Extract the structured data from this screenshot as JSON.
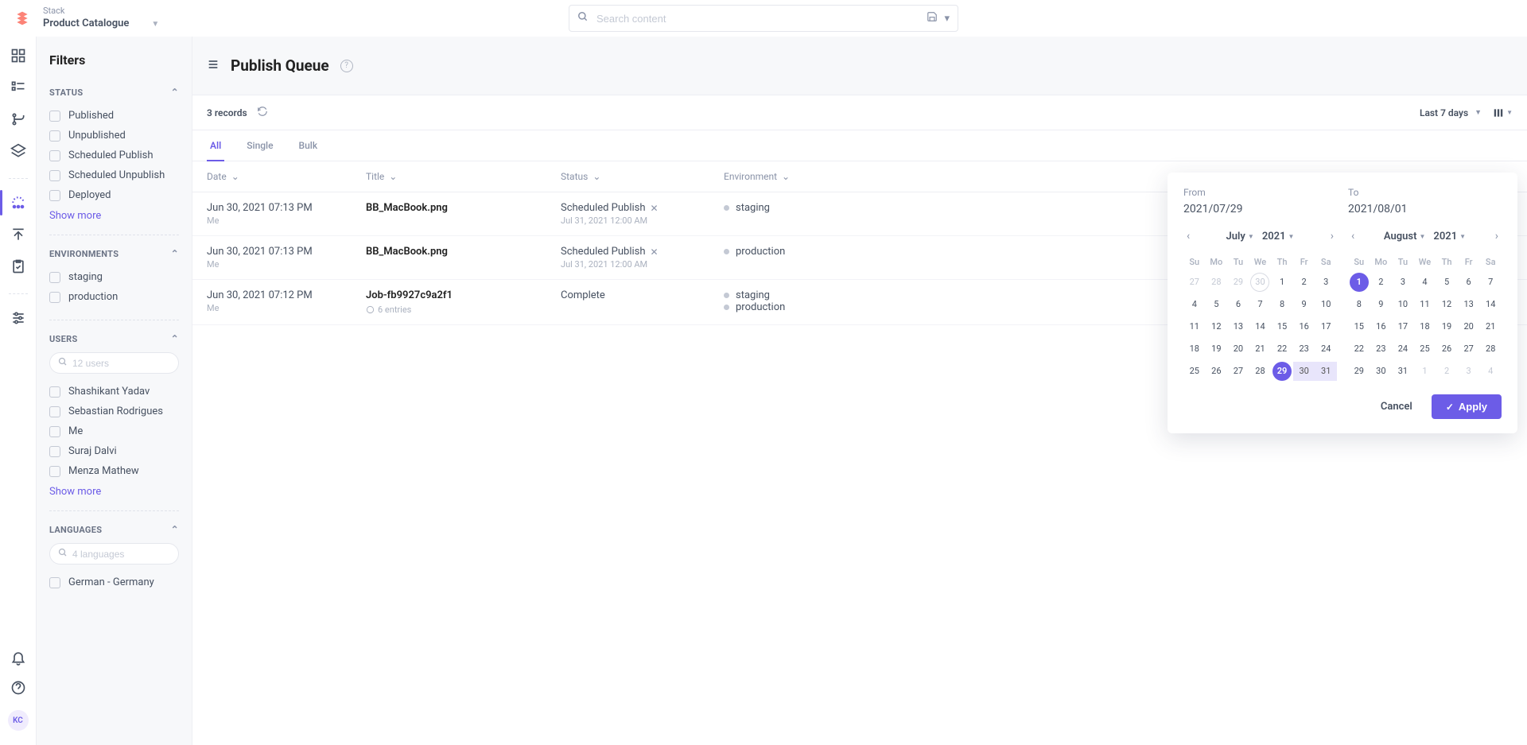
{
  "header": {
    "stack_label": "Stack",
    "stack_name": "Product Catalogue",
    "search_placeholder": "Search content"
  },
  "rail": {
    "avatar_initials": "KC"
  },
  "filters": {
    "title": "Filters",
    "sections": {
      "status": {
        "label": "STATUS",
        "items": [
          "Published",
          "Unpublished",
          "Scheduled Publish",
          "Scheduled Unpublish",
          "Deployed"
        ],
        "show_more": "Show more"
      },
      "environments": {
        "label": "ENVIRONMENTS",
        "items": [
          "staging",
          "production"
        ]
      },
      "users": {
        "label": "USERS",
        "search_placeholder": "12 users",
        "items": [
          "Shashikant Yadav",
          "Sebastian Rodrigues",
          "Me",
          "Suraj Dalvi",
          "Menza Mathew"
        ],
        "show_more": "Show more"
      },
      "languages": {
        "label": "LANGUAGES",
        "search_placeholder": "4 languages",
        "items": [
          "German - Germany"
        ]
      }
    }
  },
  "page": {
    "title": "Publish Queue",
    "records_count": "3 records",
    "date_filter": "Last 7 days"
  },
  "tabs": [
    "All",
    "Single",
    "Bulk"
  ],
  "columns": [
    "Date",
    "Title",
    "Status",
    "Environment"
  ],
  "rows": [
    {
      "date": "Jun 30, 2021 07:13 PM",
      "date_sub": "Me",
      "title": "BB_MacBook.png",
      "title_sub": "",
      "status": "Scheduled Publish",
      "status_sub": "Jul 31, 2021 12:00 AM",
      "cancellable": true,
      "envs": [
        "staging"
      ]
    },
    {
      "date": "Jun 30, 2021 07:13 PM",
      "date_sub": "Me",
      "title": "BB_MacBook.png",
      "title_sub": "",
      "status": "Scheduled Publish",
      "status_sub": "Jul 31, 2021 12:00 AM",
      "cancellable": true,
      "envs": [
        "production"
      ]
    },
    {
      "date": "Jun 30, 2021 07:12 PM",
      "date_sub": "Me",
      "title": "Job-fb9927c9a2f1",
      "title_sub": "6 entries",
      "status": "Complete",
      "status_sub": "",
      "cancellable": false,
      "envs": [
        "staging",
        "production"
      ]
    }
  ],
  "datepicker": {
    "from": {
      "label": "From",
      "value": "2021/07/29"
    },
    "to": {
      "label": "To",
      "value": "2021/08/01"
    },
    "left": {
      "month": "July",
      "year": "2021",
      "selected_day": 29,
      "range_days": [
        30,
        31
      ]
    },
    "right": {
      "month": "August",
      "year": "2021",
      "selected_day": 1
    },
    "dow": [
      "Su",
      "Mo",
      "Tu",
      "We",
      "Th",
      "Fr",
      "Sa"
    ],
    "cancel": "Cancel",
    "apply": "Apply"
  }
}
